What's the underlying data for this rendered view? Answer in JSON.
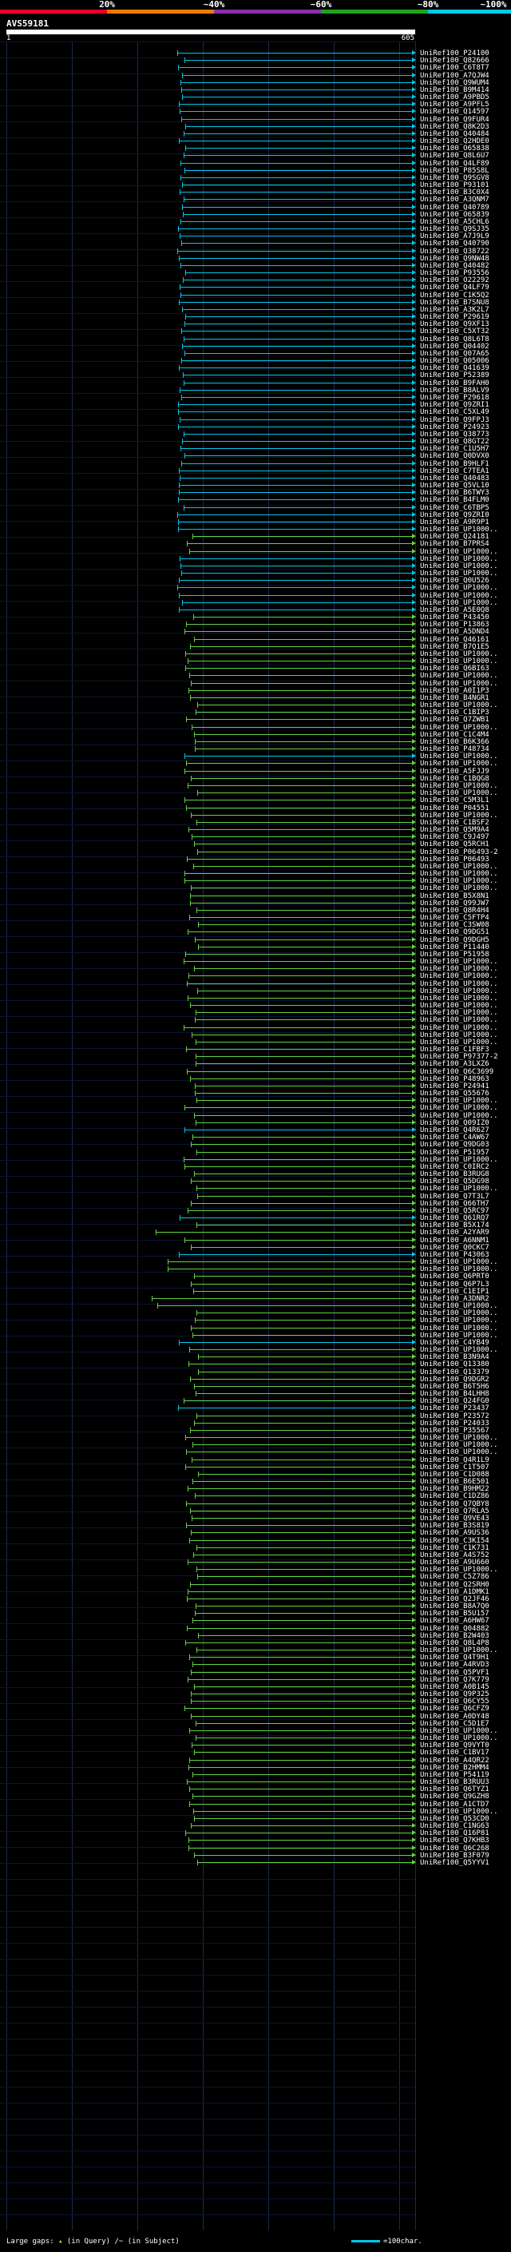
{
  "scale": {
    "labels": [
      "20%",
      "~40%",
      "~60%",
      "~80%",
      "~100%"
    ],
    "colors": [
      "#e8002a",
      "#f07b00",
      "#8b2fb0",
      "#1fa31f",
      "#00c8ea"
    ]
  },
  "query": {
    "id": "AVS59181",
    "start": "1",
    "end": "605"
  },
  "colors": {
    "high": "#00c8ea",
    "mid": "#63d244",
    "dot": "#f7d300"
  },
  "footer": {
    "gaps_label": "Large gaps:",
    "gaps_marker": "▴",
    "gaps_query": "(in Query)",
    "gaps_subject_mark": "/~",
    "gaps_subject": "(in Subject)",
    "legend": "=100char."
  },
  "hits": [
    "UniRef100_P24100",
    "UniRef100_Q82666",
    "UniRef100_C6T8T7",
    "UniRef100_A7QJW4",
    "UniRef100_Q9WUM4",
    "UniRef100_B9M414",
    "UniRef100_A9PBD5",
    "UniRef100_A9PFL5",
    "UniRef100_Q14597",
    "UniRef100_Q9FUR4",
    "UniRef100_Q8K2D3",
    "UniRef100_Q40484",
    "UniRef100_Q2HDE0",
    "UniRef100_O65838",
    "UniRef100_Q8L6U7",
    "UniRef100_Q4LF89",
    "UniRef100_P85S8L",
    "UniRef100_Q9SGV8",
    "UniRef100_P93101",
    "UniRef100_B3C0X4",
    "UniRef100_A3QNM7",
    "UniRef100_Q40789",
    "UniRef100_O65839",
    "UniRef100_A5CHL6",
    "UniRef100_Q9SJ35",
    "UniRef100_A7J9L9",
    "UniRef100_Q40790",
    "UniRef100_Q38722",
    "UniRef100_Q9NW48",
    "UniRef100_Q40482",
    "UniRef100_P93556",
    "UniRef100_O22292",
    "UniRef100_Q4LF79",
    "UniRef100_C1K5Q2",
    "UniRef100_B7SNU8",
    "UniRef100_A3K2L7",
    "UniRef100_P29619",
    "UniRef100_Q9XF13",
    "UniRef100_C5XT32",
    "UniRef100_Q8L6T8",
    "UniRef100_Q04402",
    "UniRef100_Q07A65",
    "UniRef100_Q05006",
    "UniRef100_Q41639",
    "UniRef100_P52389",
    "UniRef100_B9FAH0",
    "UniRef100_B8ALV9",
    "UniRef100_P29618",
    "UniRef100_Q9ZRI1",
    "UniRef100_C5XL49",
    "UniRef100_Q9FPJ3",
    "UniRef100_P24923",
    "UniRef100_Q38773",
    "UniRef100_Q8GT22",
    "UniRef100_C1U5H7",
    "UniRef100_Q0DVX0",
    "UniRef100_B9HLF1",
    "UniRef100_C7TEA1",
    "UniRef100_Q40483",
    "UniRef100_Q5VL10",
    "UniRef100_B6TWY3",
    "UniRef100_B4FLM0",
    "UniRef100_C6TBP5",
    "UniRef100_Q9ZRI0",
    "UniRef100_A9R9P1",
    "UniRef100_UP1000..",
    "UniRef100_Q24181",
    "UniRef100_B7PRS4",
    "UniRef100_UP1000..",
    "UniRef100_UP1000..",
    "UniRef100_UP1000..",
    "UniRef100_UP1000..",
    "UniRef100_Q0U526",
    "UniRef100_UP1000..",
    "UniRef100_UP1000..",
    "UniRef100_UP1000..",
    "UniRef100_A5E0Q8",
    "UniRef100_P43450",
    "UniRef100_P13863",
    "UniRef100_A5DND4",
    "UniRef100_Q46161",
    "UniRef100_B7Q1E5",
    "UniRef100_UP1000..",
    "UniRef100_UP1000..",
    "UniRef100_Q6BI63",
    "UniRef100_UP1000..",
    "UniRef100_UP1000..",
    "UniRef100_A0I1P3",
    "UniRef100_B4NGR1",
    "UniRef100_UP1000..",
    "UniRef100_C1BIP3",
    "UniRef100_Q7ZWB1",
    "UniRef100_UP1000..",
    "UniRef100_C1C4M4",
    "UniRef100_B6K366",
    "UniRef100_P48734",
    "UniRef100_UP1000..",
    "UniRef100_UP1000..",
    "UniRef100_A5FJJ9",
    "UniRef100_C1BQG8",
    "UniRef100_UP1000..",
    "UniRef100_UP1000..",
    "UniRef100_C5M3L1",
    "UniRef100_P04551",
    "UniRef100_UP1000..",
    "UniRef100_C1BSF2",
    "UniRef100_Q5M9A4",
    "UniRef100_C9J497",
    "UniRef100_Q5RCH1",
    "UniRef100_P06493-2",
    "UniRef100_P06493",
    "UniRef100_UP1000..",
    "UniRef100_UP1000..",
    "UniRef100_UP1000..",
    "UniRef100_UP1000..",
    "UniRef100_B5X8N1",
    "UniRef100_Q99JW7",
    "UniRef100_Q8R4H4",
    "UniRef100_C5FTP4",
    "UniRef100_C3SW08",
    "UniRef100_Q9DG51",
    "UniRef100_Q9DGH5",
    "UniRef100_P11440",
    "UniRef100_P51958",
    "UniRef100_UP1000..",
    "UniRef100_UP1000..",
    "UniRef100_UP1000..",
    "UniRef100_UP1000..",
    "UniRef100_UP1000..",
    "UniRef100_UP1000..",
    "UniRef100_UP1000..",
    "UniRef100_UP1000..",
    "UniRef100_UP1000..",
    "UniRef100_UP1000..",
    "UniRef100_UP1000..",
    "UniRef100_UP1000..",
    "UniRef100_C1FBF3",
    "UniRef100_P97377-2",
    "UniRef100_A3LXZ6",
    "UniRef100_Q6C3699",
    "UniRef100_P48963",
    "UniRef100_P24941",
    "UniRef100_Q55676",
    "UniRef100_UP1000..",
    "UniRef100_UP1000..",
    "UniRef100_UP1000..",
    "UniRef100_Q09IZ0",
    "UniRef100_Q4R627",
    "UniRef100_C4AW67",
    "UniRef100_Q9DG03",
    "UniRef100_P51957",
    "UniRef100_UP1000..",
    "UniRef100_C0IRC2",
    "UniRef100_B3RUG8",
    "UniRef100_Q5DG98",
    "UniRef100_UP1000..",
    "UniRef100_Q7T3L7",
    "UniRef100_Q66TH7",
    "UniRef100_Q5RC97",
    "UniRef100_Q61RQ7",
    "UniRef100_B5X174",
    "UniRef100_A2YAR9",
    "UniRef100_A6NNM1",
    "UniRef100_Q0CKC7",
    "UniRef100_P43063",
    "UniRef100_UP1000..",
    "UniRef100_UP1000..",
    "UniRef100_Q6PRT0",
    "UniRef100_Q6P7L3",
    "UniRef100_C1EIP1",
    "UniRef100_A3DNR2",
    "UniRef100_UP1000..",
    "UniRef100_UP1000..",
    "UniRef100_UP1000..",
    "UniRef100_UP1000..",
    "UniRef100_UP1000..",
    "UniRef100_C4YB49",
    "UniRef100_UP1000..",
    "UniRef100_B3N9A4",
    "UniRef100_Q13380",
    "UniRef100_Q13379",
    "UniRef100_Q9DGR2",
    "UniRef100_B6T5H6",
    "UniRef100_B4LHH8",
    "UniRef100_Q24FG0",
    "UniRef100_P23437",
    "UniRef100_P23572",
    "UniRef100_P24033",
    "UniRef100_P35567",
    "UniRef100_UP1000..",
    "UniRef100_UP1000..",
    "UniRef100_UP1000..",
    "UniRef100_Q4R1L9",
    "UniRef100_C1T507",
    "UniRef100_C1D088",
    "UniRef100_B6E501",
    "UniRef100_B9HM22",
    "UniRef100_C1DZ86",
    "UniRef100_Q7QBY8",
    "UniRef100_Q7RLA5",
    "UniRef100_Q9VE43",
    "UniRef100_B3S819",
    "UniRef100_A9US36",
    "UniRef100_C3KI54",
    "UniRef100_C1K731",
    "UniRef100_A4S752",
    "UniRef100_A9U660",
    "UniRef100_UP1000..",
    "UniRef100_C5Z786",
    "UniRef100_Q2SRH0",
    "UniRef100_A1DMK1",
    "UniRef100_Q2JF46",
    "UniRef100_B8A7Q0",
    "UniRef100_B5U157",
    "UniRef100_A6HW67",
    "UniRef100_Q04882",
    "UniRef100_B2W403",
    "UniRef100_Q8L4P8",
    "UniRef100_UP1000..",
    "UniRef100_Q4T9H1",
    "UniRef100_A4RVD3",
    "UniRef100_Q5PVF1",
    "UniRef100_Q7K779",
    "UniRef100_A0B145",
    "UniRef100_Q9P325",
    "UniRef100_Q6CY55",
    "UniRef100_Q6CFZ9",
    "UniRef100_A0DY48",
    "UniRef100_C5D1E7",
    "UniRef100_UP1000..",
    "UniRef100_UP1000..",
    "UniRef100_Q9VYT0",
    "UniRef100_C1BV17",
    "UniRef100_A4QR22",
    "UniRef100_B2HMM4",
    "UniRef100_P54119",
    "UniRef100_B3RUU3",
    "UniRef100_Q6TYZ1",
    "UniRef100_Q9GZH8",
    "UniRef100_A1CTD7",
    "UniRef100_UP1000..",
    "UniRef100_Q53CD0",
    "UniRef100_C1NG63",
    "UniRef100_Q16P81",
    "UniRef100_Q7KHB3",
    "UniRef100_Q6C268",
    "UniRef100_B3F079",
    "UniRef100_Q5YYV1"
  ]
}
